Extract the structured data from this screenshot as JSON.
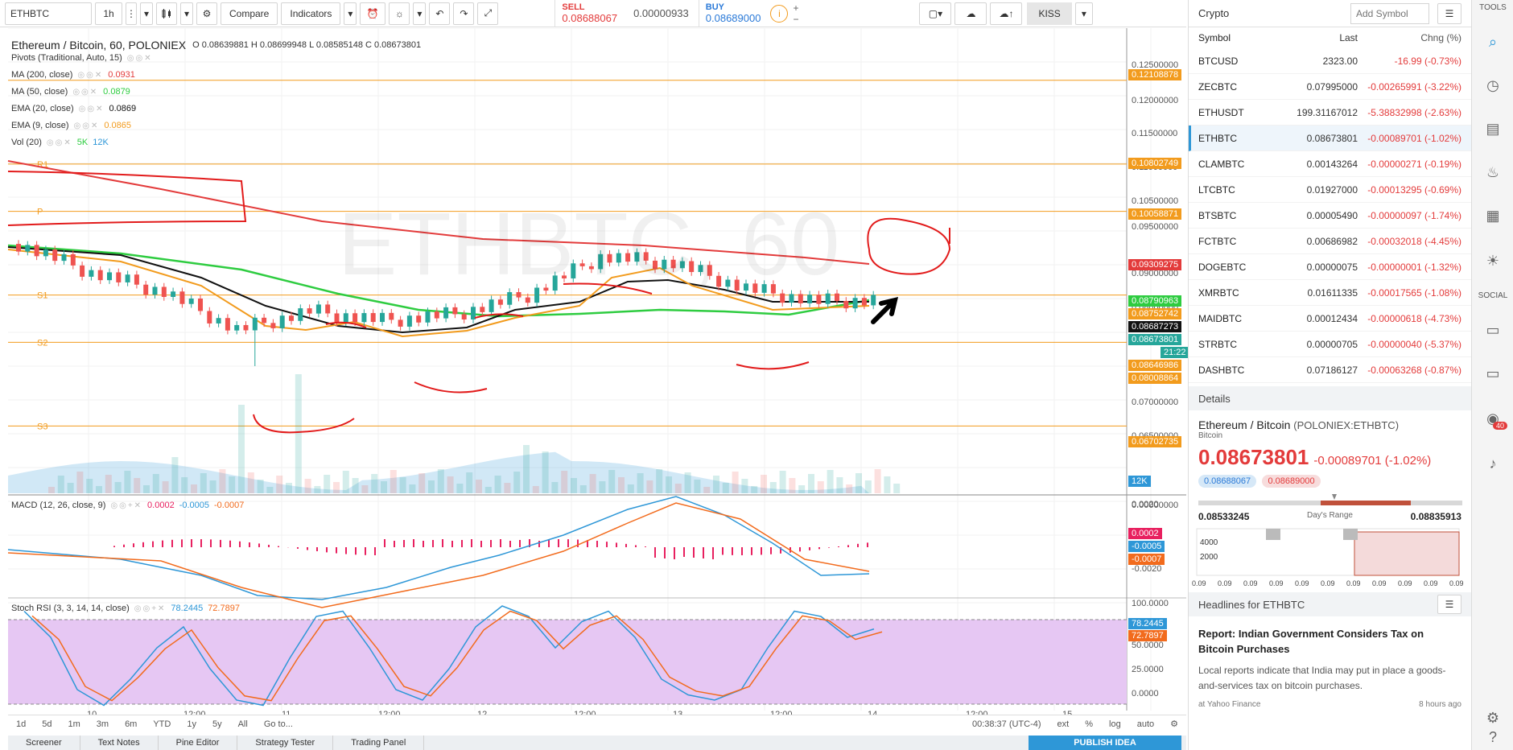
{
  "toolbar": {
    "symbol": "ETHBTC",
    "interval": "1h",
    "compare": "Compare",
    "indicators": "Indicators",
    "sell_label": "SELL",
    "sell_price": "0.08688067",
    "spread": "0.00000933",
    "buy_label": "BUY",
    "buy_price": "0.08689000",
    "kiss": "KISS"
  },
  "chart": {
    "title": "Ethereum / Bitcoin, 60, POLONIEX",
    "ohlc": "O 0.08639881 H 0.08699948 L 0.08585148 C 0.08673801",
    "watermark": "ETHBTC, 60",
    "legend": [
      {
        "label": "Pivots (Traditional, Auto, 15)",
        "value": "",
        "color": "#333333"
      },
      {
        "label": "MA (200, close)",
        "value": "0.0931",
        "color": "#e33b3b"
      },
      {
        "label": "MA (50, close)",
        "value": "0.0879",
        "color": "#2ecc40"
      },
      {
        "label": "EMA (20, close)",
        "value": "0.0869",
        "color": "#111111"
      },
      {
        "label": "EMA (9, close)",
        "value": "0.0865",
        "color": "#f29b1d"
      },
      {
        "label": "Vol (20)",
        "value": "5K",
        "value2": "12K",
        "color": "#2ecc40"
      }
    ],
    "pivot_labels": [
      "R1",
      "P",
      "S1",
      "S2",
      "S3"
    ],
    "price_ticks": [
      "0.12500000",
      "0.12000000",
      "0.11500000",
      "0.11000000",
      "0.10500000",
      "0.09500000",
      "0.09000000",
      "0.08000000",
      "0.07500000",
      "0.07000000",
      "0.06500000",
      "0.00000000"
    ],
    "axis_labels": [
      {
        "text": "0.12108878",
        "color": "#f29b1d"
      },
      {
        "text": "0.10802749",
        "color": "#f29b1d"
      },
      {
        "text": "0.10058871",
        "color": "#f29b1d"
      },
      {
        "text": "0.09309275",
        "color": "#e33b3b"
      },
      {
        "text": "0.08790963",
        "color": "#2ecc40"
      },
      {
        "text": "0.08752742",
        "color": "#f29b1d"
      },
      {
        "text": "0.08687273",
        "color": "#111111"
      },
      {
        "text": "0.08673801",
        "color": "#26a69a"
      },
      {
        "text": "21:22",
        "color": "#26a69a"
      },
      {
        "text": "0.08646986",
        "color": "#f29b1d"
      },
      {
        "text": "0.08008864",
        "color": "#f29b1d"
      },
      {
        "text": "0.06702735",
        "color": "#f29b1d"
      },
      {
        "text": "12K",
        "color": "#2e97d7"
      }
    ],
    "macd": {
      "label": "MACD (12, 26, close, 9)",
      "v1": "0.0002",
      "v2": "-0.0005",
      "v3": "-0.0007",
      "ticks": [
        "0.0020",
        "-0.0020"
      ]
    },
    "stoch": {
      "label": "Stoch RSI (3, 3, 14, 14, close)",
      "v1": "78.2445",
      "v2": "72.7897",
      "ticks": [
        "100.0000",
        "50.0000",
        "25.0000",
        "0.0000"
      ]
    },
    "time_labels": [
      "10",
      "12:00",
      "11",
      "12:00",
      "12",
      "12:00",
      "13",
      "12:00",
      "14",
      "12:00",
      "15"
    ],
    "ranges": [
      "1d",
      "5d",
      "1m",
      "3m",
      "6m",
      "YTD",
      "1y",
      "5y",
      "All",
      "Go to..."
    ],
    "clock": "00:38:37 (UTC-4)",
    "right_controls": [
      "ext",
      "%",
      "log",
      "auto"
    ]
  },
  "bottom_tabs": [
    "Screener",
    "Text Notes",
    "Pine Editor",
    "Strategy Tester",
    "Trading Panel"
  ],
  "publish": "PUBLISH IDEA",
  "watchlist": {
    "title": "Crypto",
    "add_placeholder": "Add Symbol",
    "columns": [
      "Symbol",
      "Last",
      "Chng (%)"
    ],
    "rows": [
      {
        "sym": "BTCUSD",
        "last": "2323.00",
        "chg": "-16.99 (-0.73%)"
      },
      {
        "sym": "ZECBTC",
        "last": "0.07995000",
        "chg": "-0.00265991 (-3.22%)"
      },
      {
        "sym": "ETHUSDT",
        "last": "199.31167012",
        "chg": "-5.38832998 (-2.63%)"
      },
      {
        "sym": "ETHBTC",
        "last": "0.08673801",
        "chg": "-0.00089701 (-1.02%)"
      },
      {
        "sym": "CLAMBTC",
        "last": "0.00143264",
        "chg": "-0.00000271 (-0.19%)"
      },
      {
        "sym": "LTCBTC",
        "last": "0.01927000",
        "chg": "-0.00013295 (-0.69%)"
      },
      {
        "sym": "BTSBTC",
        "last": "0.00005490",
        "chg": "-0.00000097 (-1.74%)"
      },
      {
        "sym": "FCTBTC",
        "last": "0.00686982",
        "chg": "-0.00032018 (-4.45%)"
      },
      {
        "sym": "DOGEBTC",
        "last": "0.00000075",
        "chg": "-0.00000001 (-1.32%)"
      },
      {
        "sym": "XMRBTC",
        "last": "0.01611335",
        "chg": "-0.00017565 (-1.08%)"
      },
      {
        "sym": "MAIDBTC",
        "last": "0.00012434",
        "chg": "-0.00000618 (-4.73%)"
      },
      {
        "sym": "STRBTC",
        "last": "0.00000705",
        "chg": "-0.00000040 (-5.37%)"
      },
      {
        "sym": "DASHBTC",
        "last": "0.07186127",
        "chg": "-0.00063268 (-0.87%)"
      }
    ]
  },
  "details": {
    "header": "Details",
    "name": "Ethereum / Bitcoin",
    "exchange": "(POLONIEX:ETHBTC)",
    "sub": "Bitcoin",
    "price": "0.08673801",
    "change": "-0.00089701 (-1.02%)",
    "bid": "0.08688067",
    "ask": "0.08689000",
    "low": "0.08533245",
    "range_label": "Day's Range",
    "high": "0.08835913",
    "vol_ticks": [
      "4000",
      "2000"
    ],
    "mini_axis": "0.09"
  },
  "headlines": {
    "header": "Headlines for ETHBTC",
    "title": "Report: Indian Government Considers Tax on Bitcoin Purchases",
    "body": "Local reports indicate that India may put in place a goods-and-services tax on bitcoin purchases.",
    "source": "at Yahoo Finance",
    "time": "8 hours ago"
  },
  "sidebar": {
    "tools": "TOOLS",
    "social": "SOCIAL",
    "badge": "40"
  }
}
